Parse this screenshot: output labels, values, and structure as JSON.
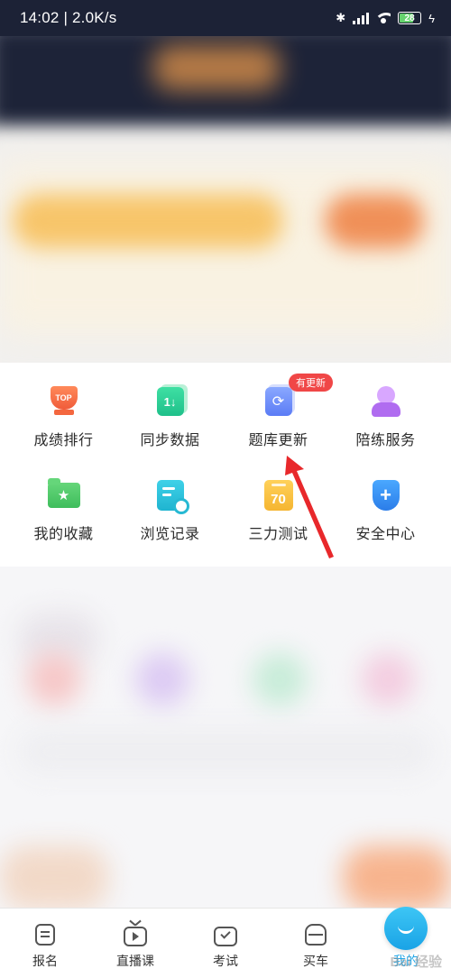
{
  "status_bar": {
    "time_speed": "14:02 | 2.0K/s",
    "battery": "28",
    "bluetooth_icon": "bluetooth-icon",
    "signal_icon": "signal-icon",
    "wifi_icon": "wifi-icon",
    "charging_icon": "charging-icon"
  },
  "grid": {
    "items": [
      {
        "label": "成绩排行",
        "icon": "trophy-icon",
        "icon_text": "TOP"
      },
      {
        "label": "同步数据",
        "icon": "sync-data-icon",
        "icon_text": "1↓"
      },
      {
        "label": "题库更新",
        "icon": "question-bank-icon"
      },
      {
        "label": "陪练服务",
        "icon": "coach-icon"
      },
      {
        "label": "我的收藏",
        "icon": "favorites-folder-icon"
      },
      {
        "label": "浏览记录",
        "icon": "history-icon"
      },
      {
        "label": "三力测试",
        "icon": "score-icon",
        "icon_text": "70"
      },
      {
        "label": "安全中心",
        "icon": "shield-icon",
        "icon_text": "+"
      }
    ],
    "update_badge": "有更新"
  },
  "tabbar": {
    "items": [
      {
        "label": "报名",
        "icon": "register-icon"
      },
      {
        "label": "直播课",
        "icon": "live-tv-icon"
      },
      {
        "label": "考试",
        "icon": "exam-icon"
      },
      {
        "label": "买车",
        "icon": "car-icon"
      },
      {
        "label": "我的",
        "icon": "me-icon",
        "active": true
      }
    ]
  },
  "watermark": "Bai 经验",
  "colors": {
    "status_bg": "#1c2236",
    "accent_blue": "#21a7e8",
    "badge_red": "#f04747",
    "arrow_red": "#e8282b"
  }
}
